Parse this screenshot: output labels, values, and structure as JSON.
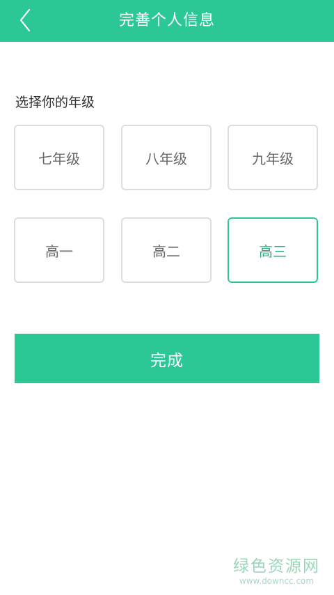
{
  "header": {
    "title": "完善个人信息",
    "back_icon": "chevron-left-icon"
  },
  "colors": {
    "accent": "#2bc896",
    "selected_text": "#26a97d",
    "border": "#dddddd"
  },
  "grade_section": {
    "label": "选择你的年级",
    "options": [
      {
        "label": "七年级",
        "selected": false
      },
      {
        "label": "八年级",
        "selected": false
      },
      {
        "label": "九年级",
        "selected": false
      },
      {
        "label": "高一",
        "selected": false
      },
      {
        "label": "高二",
        "selected": false
      },
      {
        "label": "高三",
        "selected": true
      }
    ]
  },
  "submit": {
    "label": "完成"
  },
  "watermark": {
    "text": "绿色资源网",
    "url": "www.downcc.com"
  }
}
